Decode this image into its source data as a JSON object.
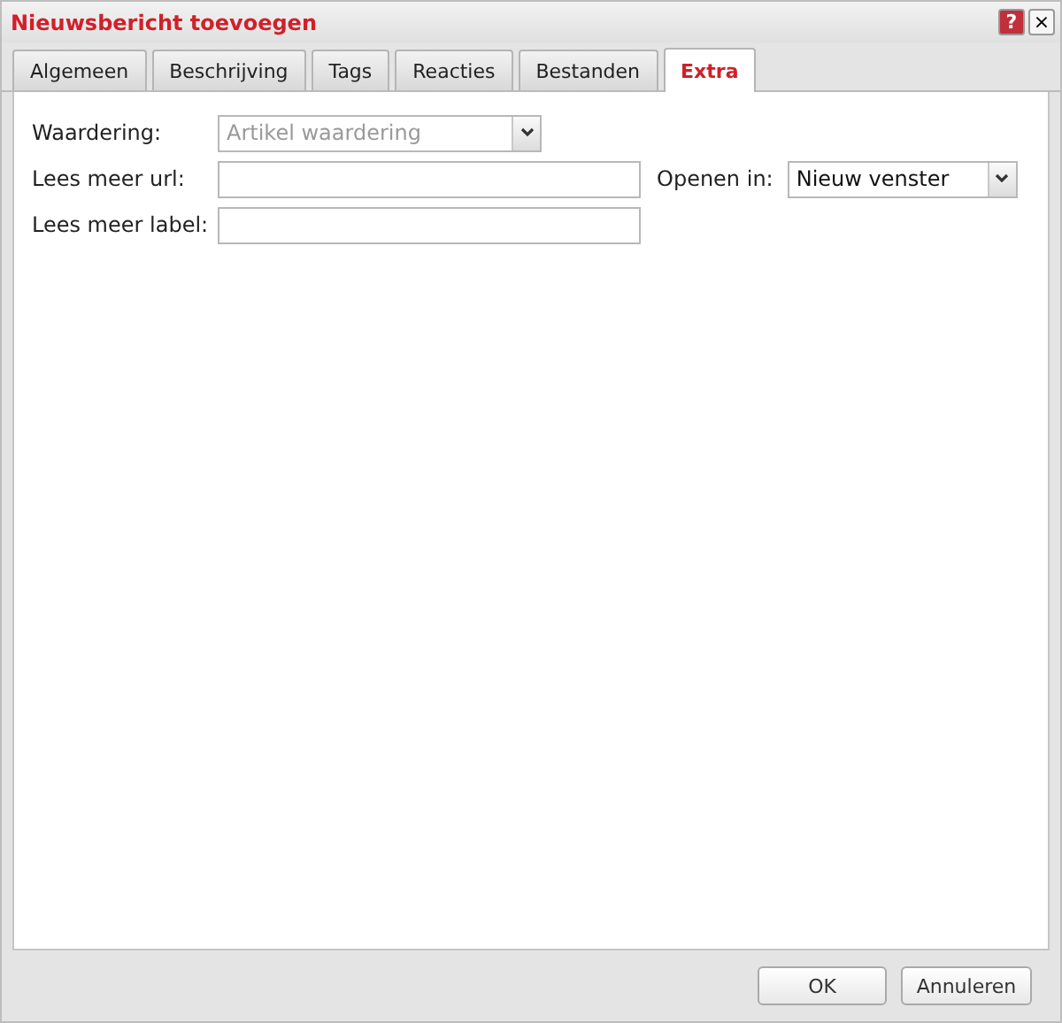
{
  "window": {
    "title": "Nieuwsbericht toevoegen",
    "title_buttons": [
      {
        "kind": "help",
        "label": "?"
      },
      {
        "kind": "close",
        "label": "×"
      }
    ]
  },
  "tabs": [
    {
      "label": "Algemeen",
      "selected": false
    },
    {
      "label": "Beschrijving",
      "selected": false
    },
    {
      "label": "Tags",
      "selected": false
    },
    {
      "label": "Reacties",
      "selected": false
    },
    {
      "label": "Bestanden",
      "selected": false
    },
    {
      "label": "Extra",
      "selected": true
    }
  ],
  "form_rows": [
    {
      "label": "Waardering:",
      "fields": [
        {
          "kind": "select",
          "placeholder": "Artikel waardering"
        }
      ]
    },
    {
      "label": "Lees meer url:",
      "fields": [
        {
          "kind": "text"
        },
        {
          "kind": "select",
          "label": "Openen in:",
          "value": "Nieuw venster"
        }
      ]
    },
    {
      "label": "Lees meer label:",
      "fields": [
        {
          "kind": "text"
        }
      ]
    }
  ],
  "buttons": [
    "OK",
    "Annuleren"
  ]
}
